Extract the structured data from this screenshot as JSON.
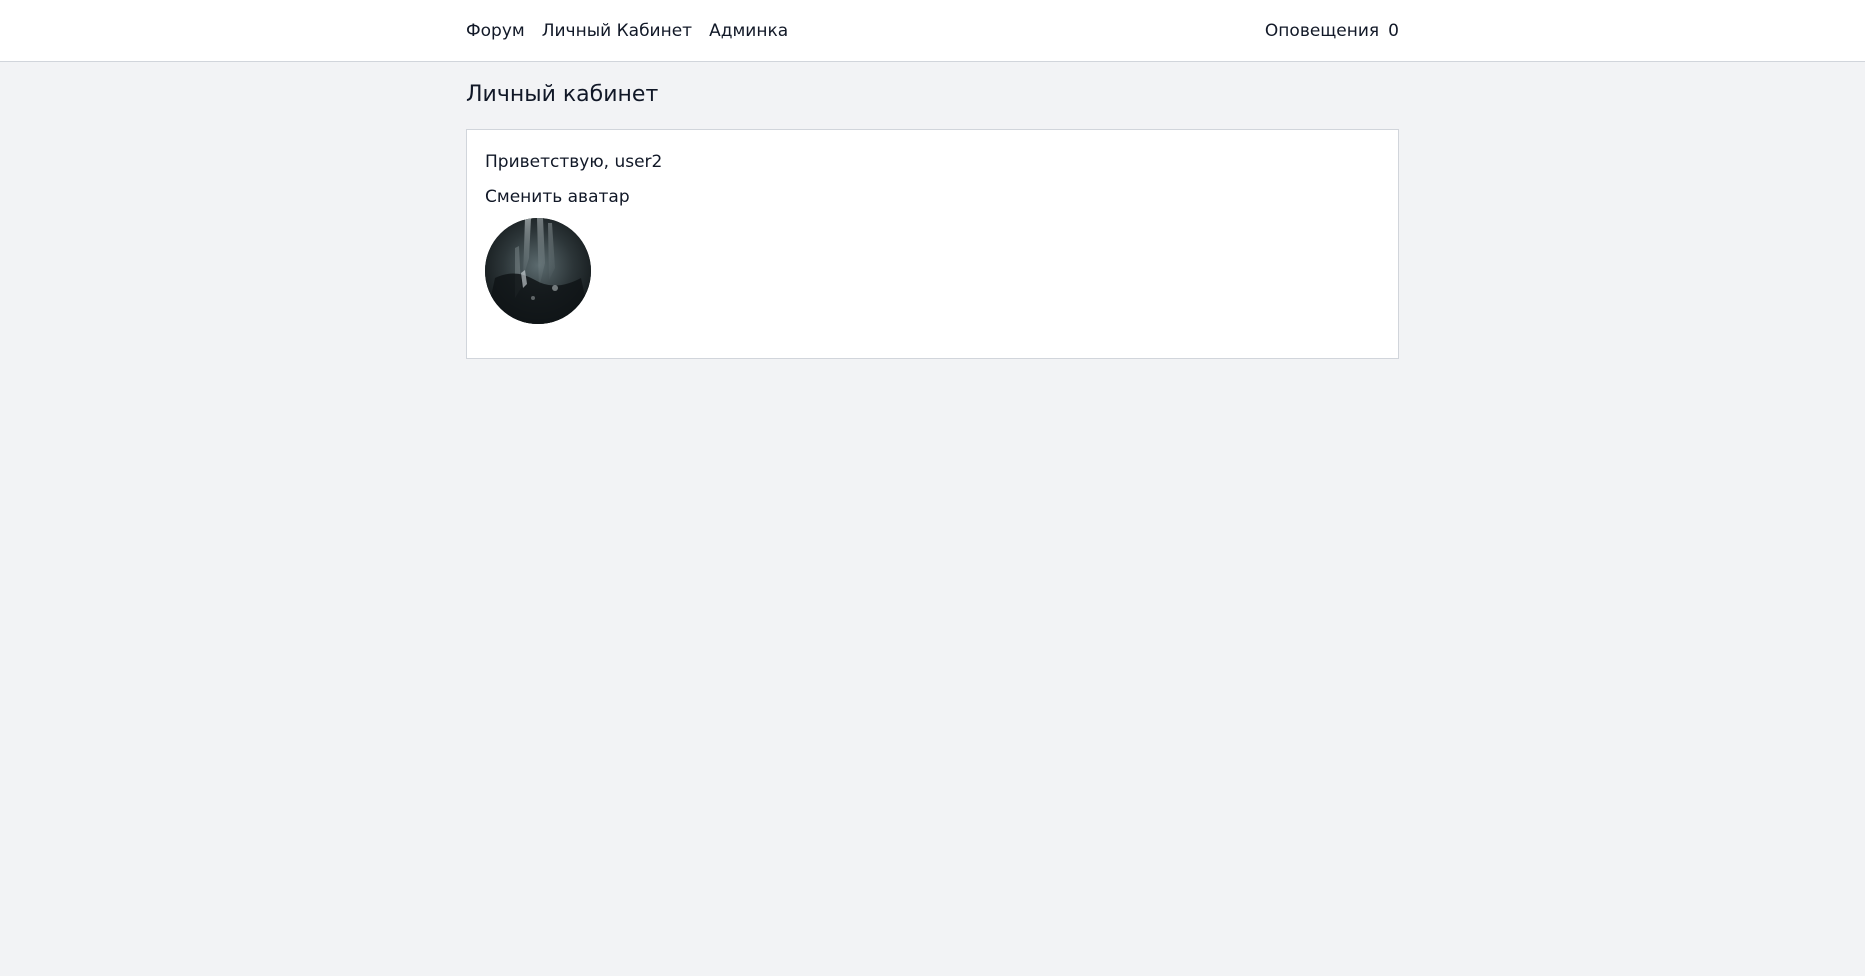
{
  "nav": {
    "forum": "Форум",
    "cabinet": "Личный Кабинет",
    "admin": "Админка",
    "notifications_label": "Оповещения",
    "notifications_count": "0"
  },
  "page": {
    "title": "Личный кабинет"
  },
  "profile": {
    "greeting": "Приветствую, user2",
    "change_avatar": "Сменить аватар",
    "avatar_alt": "avatar"
  },
  "colors": {
    "background": "#f2f3f5",
    "card_border": "#d1d5db",
    "text": "#111827"
  }
}
